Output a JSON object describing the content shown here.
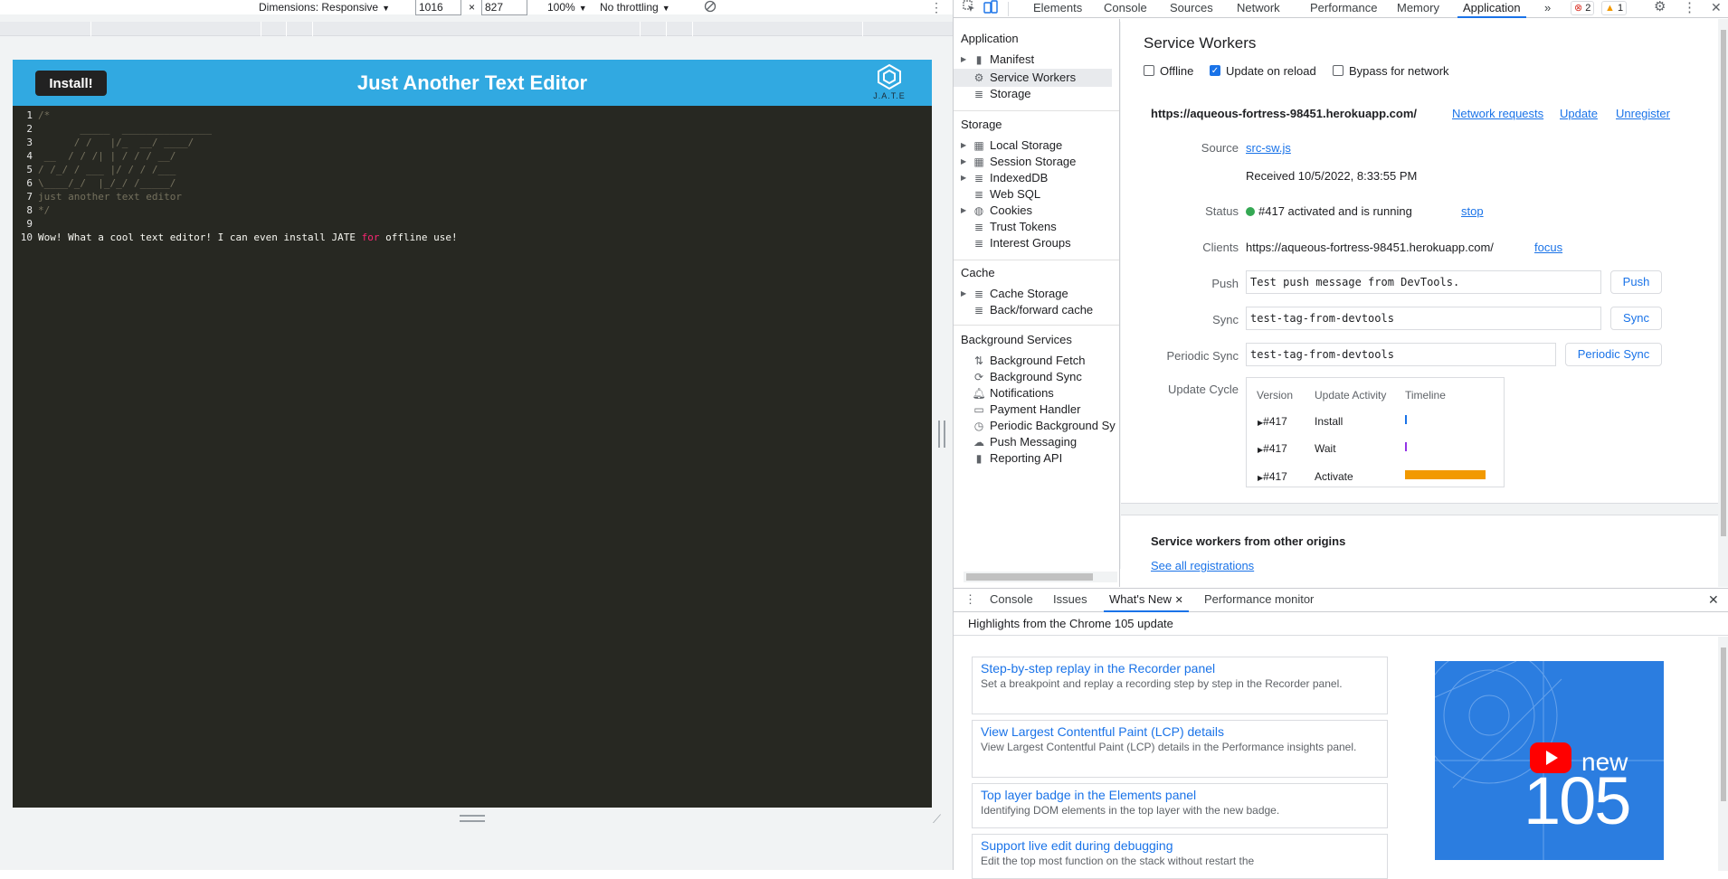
{
  "device_toolbar": {
    "dimensions_label": "Dimensions: Responsive",
    "width_value": "1016",
    "times": "×",
    "height_value": "827",
    "zoom": "100%",
    "throttling": "No throttling"
  },
  "app": {
    "install_label": "Install!",
    "title": "Just Another Text Editor",
    "logo_text": "J.A.T.E",
    "accent_color": "#31a9e1",
    "editor_lines": [
      {
        "n": "1",
        "text": "/*"
      },
      {
        "n": "2",
        "text": "       _____  _______________"
      },
      {
        "n": "3",
        "text": "      / /   |/_  __/ ____/"
      },
      {
        "n": "4",
        "text": " __  / / /| | / / / __/"
      },
      {
        "n": "5",
        "text": "/ /_/ / ___ |/ / / /___"
      },
      {
        "n": "6",
        "text": "\\____/_/  |_/_/ /_____/"
      },
      {
        "n": "7",
        "text": "just another text editor"
      },
      {
        "n": "8",
        "text": "*/"
      },
      {
        "n": "9",
        "text": ""
      }
    ],
    "line10": {
      "n": "10",
      "before": "Wow! What a cool text editor! I can even install JATE ",
      "keyword": "for",
      "after": " offline use!"
    }
  },
  "devtools": {
    "tabs": [
      "Elements",
      "Console",
      "Sources",
      "Network",
      "Performance",
      "Memory",
      "Application"
    ],
    "active_tab": "Application",
    "more_tabs": "»",
    "errors_count": "2",
    "warnings_count": "1",
    "sidebar": {
      "application_head": "Application",
      "application_items": [
        "Manifest",
        "Service Workers",
        "Storage"
      ],
      "storage_head": "Storage",
      "storage_items": [
        "Local Storage",
        "Session Storage",
        "IndexedDB",
        "Web SQL",
        "Cookies",
        "Trust Tokens",
        "Interest Groups"
      ],
      "cache_head": "Cache",
      "cache_items": [
        "Cache Storage",
        "Back/forward cache"
      ],
      "bg_head": "Background Services",
      "bg_items": [
        "Background Fetch",
        "Background Sync",
        "Notifications",
        "Payment Handler",
        "Periodic Background Sy",
        "Push Messaging",
        "Reporting API"
      ]
    },
    "service_workers": {
      "title": "Service Workers",
      "offline": "Offline",
      "update_on_reload": "Update on reload",
      "bypass": "Bypass for network",
      "origin": "https://aqueous-fortress-98451.herokuapp.com/",
      "network_requests": "Network requests",
      "update": "Update",
      "unregister": "Unregister",
      "source_label": "Source",
      "source_file": "src-sw.js",
      "received": "Received 10/5/2022, 8:33:55 PM",
      "status_label": "Status",
      "status_text": "#417 activated and is running",
      "stop": "stop",
      "clients_label": "Clients",
      "clients_value": "https://aqueous-fortress-98451.herokuapp.com/",
      "focus": "focus",
      "push_label": "Push",
      "push_value": "Test push message from DevTools.",
      "push_btn": "Push",
      "sync_label": "Sync",
      "sync_value": "test-tag-from-devtools",
      "sync_btn": "Sync",
      "periodic_label": "Periodic Sync",
      "periodic_value": "test-tag-from-devtools",
      "periodic_btn": "Periodic Sync",
      "update_cycle_label": "Update Cycle",
      "uc_headers": [
        "Version",
        "Update Activity",
        "Timeline"
      ],
      "uc_rows": [
        {
          "version": "#417",
          "activity": "Install",
          "color": "#1a73e8"
        },
        {
          "version": "#417",
          "activity": "Wait",
          "color": "#9334e6"
        },
        {
          "version": "#417",
          "activity": "Activate",
          "color": "#f29900"
        }
      ],
      "other_origins": "Service workers from other origins",
      "see_all": "See all registrations"
    },
    "drawer": {
      "tabs": [
        "Console",
        "Issues",
        "What's New",
        "Performance monitor"
      ],
      "active": "What's New",
      "highlights": "Highlights from the Chrome 105 update",
      "cards": [
        {
          "title": "Step-by-step replay in the Recorder panel",
          "desc": "Set a breakpoint and replay a recording step by step in the Recorder panel."
        },
        {
          "title": "View Largest Contentful Paint (LCP) details",
          "desc": "View Largest Contentful Paint (LCP) details in the Performance insights panel."
        },
        {
          "title": "Top layer badge in the Elements panel",
          "desc": "Identifying DOM elements in the top layer with the new badge."
        },
        {
          "title": "Support live edit during debugging",
          "desc": "Edit the top most function on the stack without restart the"
        }
      ],
      "video_new": "new",
      "video_version": "105"
    }
  }
}
